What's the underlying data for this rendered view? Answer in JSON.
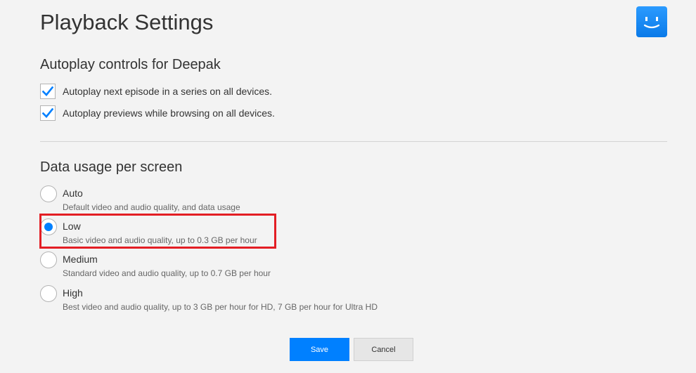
{
  "page": {
    "title": "Playback Settings"
  },
  "autoplay": {
    "heading": "Autoplay controls for Deepak",
    "options": [
      {
        "label": "Autoplay next episode in a series on all devices.",
        "checked": true
      },
      {
        "label": "Autoplay previews while browsing on all devices.",
        "checked": true
      }
    ]
  },
  "data_usage": {
    "heading": "Data usage per screen",
    "selected": "Low",
    "options": [
      {
        "title": "Auto",
        "description": "Default video and audio quality, and data usage"
      },
      {
        "title": "Low",
        "description": "Basic video and audio quality, up to 0.3 GB per hour"
      },
      {
        "title": "Medium",
        "description": "Standard video and audio quality, up to 0.7 GB per hour"
      },
      {
        "title": "High",
        "description": "Best video and audio quality, up to 3 GB per hour for HD, 7 GB per hour for Ultra HD"
      }
    ]
  },
  "actions": {
    "save_label": "Save",
    "cancel_label": "Cancel"
  },
  "colors": {
    "accent": "#0080ff",
    "highlight": "#e31e24",
    "avatar": "#1a8cff"
  },
  "icons": {
    "avatar": "smiley-avatar-icon",
    "checkbox": "checkmark-icon"
  }
}
